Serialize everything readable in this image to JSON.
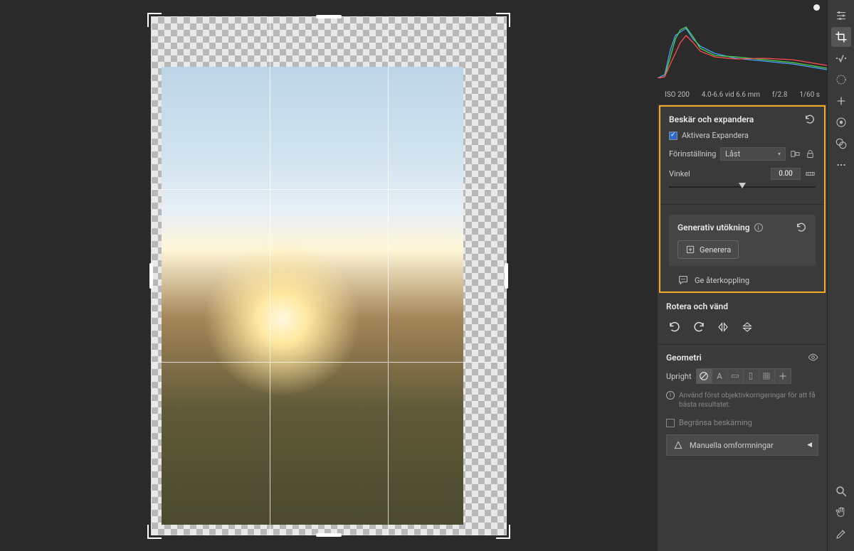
{
  "meta": {
    "iso": "ISO 200",
    "focal": "4.0-6.6 vid 6.6 mm",
    "aperture": "f/2.8",
    "shutter": "1/60 s"
  },
  "crop": {
    "title": "Beskär och expandera",
    "enable_expand": "Aktivera Expandera",
    "preset_label": "Förinställning",
    "preset_value": "Låst",
    "angle_label": "Vinkel",
    "angle_value": "0.00"
  },
  "gen": {
    "title": "Generativ utökning",
    "generate": "Generera",
    "feedback": "Ge återkoppling"
  },
  "rotate": {
    "title": "Rotera och vänd"
  },
  "geometry": {
    "title": "Geometri",
    "upright_label": "Upright",
    "hint": "Använd först objektivkorrigeringar för att få bästa resultatet.",
    "limit_crop": "Begränsa beskärning",
    "manual": "Manuella omformningar"
  }
}
